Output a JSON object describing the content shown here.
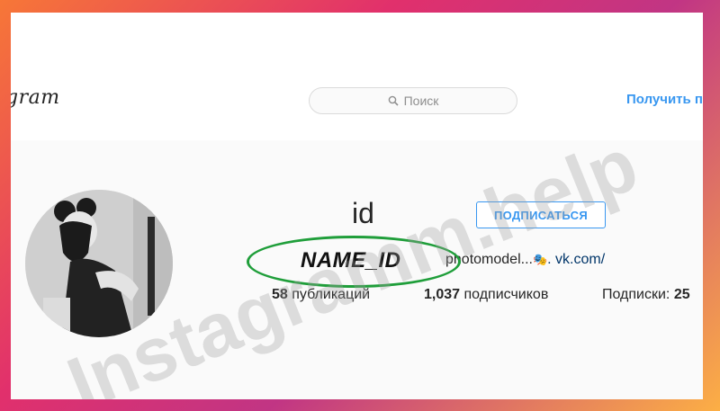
{
  "header": {
    "logo_text": "gram",
    "search_placeholder": "Поиск",
    "get_app_label": "Получить пр"
  },
  "profile": {
    "username": "id",
    "follow_label": "ПОДПИСАТЬСЯ",
    "display_name": "NAME_ID",
    "bio_text": "photomodel...",
    "bio_emoji": "🎭",
    "bio_link": ". vk.com/",
    "stats": {
      "posts_count": "58",
      "posts_label": "публикаций",
      "followers_count": "1,037",
      "followers_label": "подписчиков",
      "following_label": "Подписки:",
      "following_count": "25"
    }
  },
  "watermark": "Instagramm.help",
  "colors": {
    "accent": "#3897f0",
    "highlight_ring": "#1f9e3a"
  }
}
